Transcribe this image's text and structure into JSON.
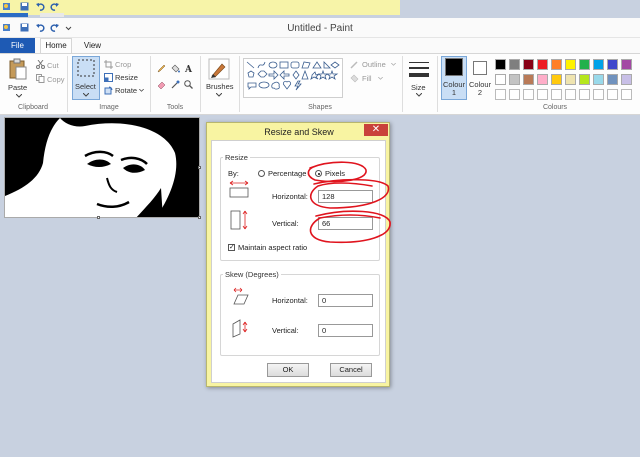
{
  "window": {
    "title": "Untitled - Paint"
  },
  "tabs": {
    "file": "File",
    "home": "Home",
    "view": "View"
  },
  "ribbon": {
    "clipboard": {
      "paste": "Paste",
      "cut": "Cut",
      "copy": "Copy",
      "label": "Clipboard"
    },
    "image": {
      "select": "Select",
      "crop": "Crop",
      "resize": "Resize",
      "rotate": "Rotate",
      "label": "Image"
    },
    "tools": {
      "label": "Tools"
    },
    "brushes": {
      "label": "Brushes"
    },
    "shapes": {
      "outline": "Outline",
      "fill": "Fill",
      "label": "Shapes"
    },
    "size": {
      "label": "Size"
    },
    "colours": {
      "colour1": "Colour 1",
      "colour2": "Colour 2",
      "label": "Colours",
      "primary": "#000000",
      "secondary": "#ffffff",
      "palette_row1": [
        "#000000",
        "#7f7f7f",
        "#880015",
        "#ed1c24",
        "#ff7f27",
        "#fff200",
        "#22b14c",
        "#00a2e8",
        "#3f48cc",
        "#a349a4"
      ],
      "palette_row2": [
        "#ffffff",
        "#c3c3c3",
        "#b97a57",
        "#ffaec9",
        "#ffc90e",
        "#efe4b0",
        "#b5e61d",
        "#99d9ea",
        "#7092be",
        "#c8bfe7"
      ]
    }
  },
  "dialog": {
    "title": "Resize and Skew",
    "close": "✕",
    "resize": {
      "legend": "Resize",
      "by_label": "By:",
      "percentage_label": "Percentage",
      "pixels_label": "Pixels",
      "selected": "Pixels",
      "horizontal_label": "Horizontal:",
      "horizontal_value": "128",
      "vertical_label": "Vertical:",
      "vertical_value": "66",
      "maintain_label": "Maintain aspect ratio",
      "maintain_checked": true
    },
    "skew": {
      "legend": "Skew (Degrees)",
      "horizontal_label": "Horizontal:",
      "horizontal_value": "0",
      "vertical_label": "Vertical:",
      "vertical_value": "0"
    },
    "ok": "OK",
    "cancel": "Cancel"
  },
  "annotation_color": "#e0141e"
}
